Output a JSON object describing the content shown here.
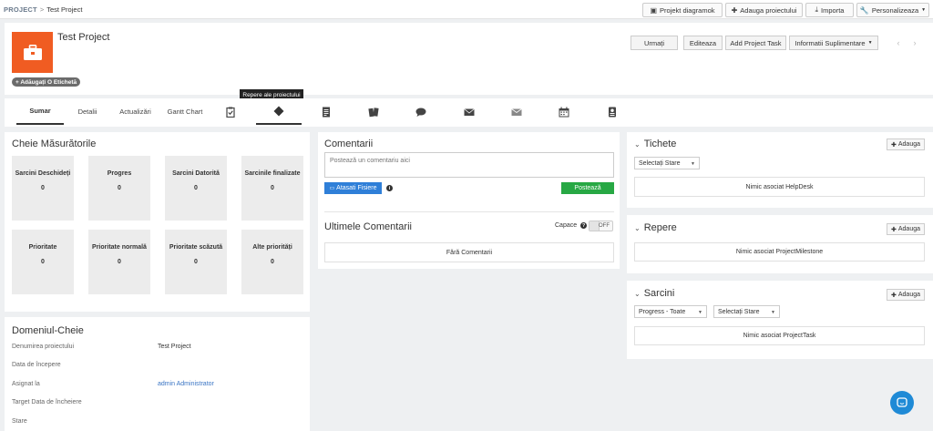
{
  "breadcrumb": {
    "root": "PROJECT",
    "separator": ">",
    "current": "Test Project"
  },
  "topbar": {
    "buttons": [
      {
        "label": "Projekt diagramok",
        "icon": "image-icon"
      },
      {
        "label": "Adauga proiectului",
        "icon": "plus-icon"
      },
      {
        "label": "Importa",
        "icon": "download-icon"
      },
      {
        "label": "Personalizeaza",
        "icon": "wrench-icon"
      }
    ]
  },
  "header": {
    "title": "Test Project",
    "tag_label": "+ Adăugați O Etichetă",
    "actions": [
      "Urmați",
      "Editeaza",
      "Add Project Task",
      "Informatii Suplimentare"
    ],
    "prev": "‹",
    "next": "›"
  },
  "tooltip": "Repere ale proiectului",
  "tabs": {
    "text_tabs": [
      "Sumar",
      "Detalii",
      "Actualizări",
      "Gantt Chart"
    ],
    "icon_tabs": [
      "clipboard-check-icon",
      "milestone-diamond-icon",
      "document-icon",
      "files-icon",
      "comment-icon",
      "envelope-icon",
      "envelope-closed-icon",
      "calendar-icon",
      "badge-icon"
    ]
  },
  "key_metrics": {
    "title": "Cheie Măsurătorile",
    "items": [
      {
        "label": "Sarcini Deschideți",
        "value": "0"
      },
      {
        "label": "Progres",
        "value": "0"
      },
      {
        "label": "Sarcini Datorită",
        "value": "0"
      },
      {
        "label": "Sarcinile finalizate",
        "value": "0"
      },
      {
        "label": "Prioritate",
        "value": "0"
      },
      {
        "label": "Prioritate normală",
        "value": "0"
      },
      {
        "label": "Prioritate scăzută",
        "value": "0"
      },
      {
        "label": "Alte priorități",
        "value": "0"
      }
    ]
  },
  "key_fields": {
    "title": "Domeniul-Cheie",
    "rows": [
      {
        "label": "Denumirea proiectului",
        "value": "Test Project"
      },
      {
        "label": "Data de începere",
        "value": ""
      },
      {
        "label": "Asignat la",
        "value": "admin Administrator"
      },
      {
        "label": "Target Data de încheiere",
        "value": ""
      },
      {
        "label": "Stare",
        "value": ""
      }
    ]
  },
  "comments": {
    "title": "Comentarii",
    "placeholder": "Postează un comentariu aici",
    "attach_label": "Atasati Fisiere",
    "post_label": "Postează",
    "latest_title": "Ultimele Comentarii",
    "capace_label": "Capace",
    "toggle_label": "OFF",
    "empty": "Fără Comentarii"
  },
  "tickets": {
    "title": "Tichete",
    "add_label": "Adauga",
    "select_label": "Selectați Stare",
    "empty": "Nimic asociat HelpDesk"
  },
  "milestones": {
    "title": "Repere",
    "add_label": "Adauga",
    "empty": "Nimic asociat ProjectMilestone"
  },
  "tasks": {
    "title": "Sarcini",
    "add_label": "Adauga",
    "progress_select": "Progress - Toate",
    "state_select": "Selectați Stare",
    "empty": "Nimic asociat ProjectTask"
  },
  "colors": {
    "accent": "#f05c22",
    "primary": "#2f7fd8",
    "success": "#27a844",
    "chat": "#1f8ad6"
  }
}
